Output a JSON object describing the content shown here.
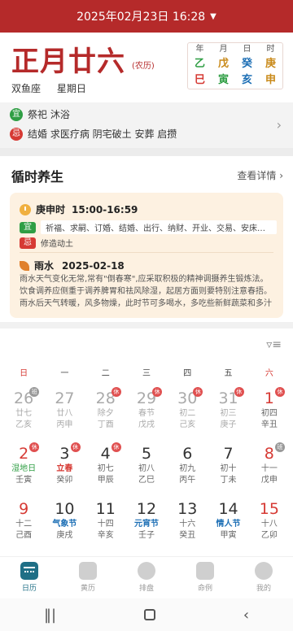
{
  "header": {
    "datetime": "2025年02月23日 16:28"
  },
  "day": {
    "lunar": "正月廿六",
    "lunar_tag": "(农历)",
    "constellation": "双鱼座",
    "weekday": "星期日",
    "ganzhi": {
      "head": [
        "年",
        "月",
        "日",
        "时"
      ],
      "top": [
        {
          "t": "乙",
          "color": "#2f9e44"
        },
        {
          "t": "戊",
          "color": "#c98a1a"
        },
        {
          "t": "癸",
          "color": "#1d6fb5"
        },
        {
          "t": "庚",
          "color": "#c98a1a"
        }
      ],
      "bottom": [
        {
          "t": "巳",
          "color": "#d63a34"
        },
        {
          "t": "寅",
          "color": "#2f9e44"
        },
        {
          "t": "亥",
          "color": "#1d6fb5"
        },
        {
          "t": "申",
          "color": "#c98a1a"
        }
      ]
    }
  },
  "yiji": {
    "yi_badge": "宜",
    "yi_text": "祭祀 沐浴",
    "ji_badge": "忌",
    "ji_text": "结婚 求医疗病 阴宅破土 安葬 启攒"
  },
  "health": {
    "title": "循时养生",
    "see_more": "查看详情 ›",
    "hour_name": "庚申时",
    "hour_range": "15:00-16:59",
    "yi_badge": "宜",
    "yi_text": "祈福、求嗣、订婚、结婚、出行、纳财、开业、交易、安床、入...",
    "ji_badge": "忌",
    "ji_text": "修造动土",
    "term_name": "雨水",
    "term_date": "2025-02-18",
    "term_text": "雨水天气变化无常,常有\"倒春寒\",应采取积极的精神调摄养生锻炼法。饮食调养应侧重于调养脾胃和祛风除湿，起居方面则要特别注意春捂。雨水后天气转暖，风多物燥，此时节可多喝水，多吃些新鲜蔬菜和多汁水果，..."
  },
  "calendar": {
    "weekdays": [
      "日",
      "一",
      "二",
      "三",
      "四",
      "五",
      "六"
    ],
    "weeks": [
      [
        {
          "num": "26",
          "l1": "廿七",
          "l2": "乙亥",
          "dim": true,
          "mark": "班",
          "mark_type": "work"
        },
        {
          "num": "27",
          "l1": "廿八",
          "l2": "丙申",
          "dim": true
        },
        {
          "num": "28",
          "l1": "除夕",
          "l2": "丁酉",
          "dim": true,
          "mark": "休",
          "mark_type": "rest"
        },
        {
          "num": "29",
          "l1": "春节",
          "l2": "戊戌",
          "dim": true,
          "mark": "休",
          "mark_type": "rest"
        },
        {
          "num": "30",
          "l1": "初二",
          "l2": "己亥",
          "dim": true,
          "mark": "休",
          "mark_type": "rest"
        },
        {
          "num": "31",
          "l1": "初三",
          "l2": "庚子",
          "dim": true,
          "mark": "休",
          "mark_type": "rest"
        },
        {
          "num": "1",
          "l1": "初四",
          "l2": "辛丑",
          "red": true,
          "mark": "休",
          "mark_type": "rest"
        }
      ],
      [
        {
          "num": "2",
          "l1": "湿地日",
          "l2": "壬寅",
          "red": true,
          "l1c": "green",
          "mark": "休",
          "mark_type": "rest"
        },
        {
          "num": "3",
          "l1": "立春",
          "l2": "癸卯",
          "l1c": "redt",
          "mark": "休",
          "mark_type": "rest"
        },
        {
          "num": "4",
          "l1": "初七",
          "l2": "甲辰",
          "mark": "休",
          "mark_type": "rest"
        },
        {
          "num": "5",
          "l1": "初八",
          "l2": "乙巳"
        },
        {
          "num": "6",
          "l1": "初九",
          "l2": "丙午"
        },
        {
          "num": "7",
          "l1": "初十",
          "l2": "丁未"
        },
        {
          "num": "8",
          "l1": "十一",
          "l2": "戊申",
          "red": true,
          "mark": "班",
          "mark_type": "work"
        }
      ],
      [
        {
          "num": "9",
          "l1": "十二",
          "l2": "己酉",
          "red": true
        },
        {
          "num": "10",
          "l1": "气象节",
          "l2": "庚戌",
          "l1c": "blue"
        },
        {
          "num": "11",
          "l1": "十四",
          "l2": "辛亥"
        },
        {
          "num": "12",
          "l1": "元宵节",
          "l2": "壬子",
          "l1c": "blue"
        },
        {
          "num": "13",
          "l1": "十六",
          "l2": "癸丑"
        },
        {
          "num": "14",
          "l1": "情人节",
          "l2": "甲寅",
          "l1c": "blue"
        },
        {
          "num": "15",
          "l1": "十八",
          "l2": "乙卯",
          "red": true
        }
      ]
    ]
  },
  "tabs": [
    {
      "label": "日历",
      "active": true,
      "icon": "calendar-icon"
    },
    {
      "label": "黄历",
      "active": false,
      "icon": "almanac-icon"
    },
    {
      "label": "排盘",
      "active": false,
      "icon": "yinyang-icon"
    },
    {
      "label": "命例",
      "active": false,
      "icon": "book-icon"
    },
    {
      "label": "我的",
      "active": false,
      "icon": "profile-icon"
    }
  ]
}
